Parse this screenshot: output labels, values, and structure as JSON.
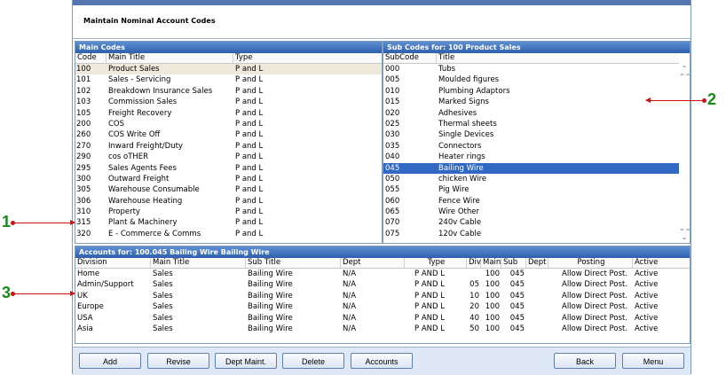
{
  "window": {
    "title": "Maintain Nominal Account Codes"
  },
  "main_codes": {
    "header": "Main Codes",
    "columns": [
      "Code",
      "Main Title",
      "Type"
    ],
    "rows": [
      {
        "code": "100",
        "title": "Product Sales",
        "type": "P and L"
      },
      {
        "code": "101",
        "title": "Sales - Servicing",
        "type": "P and L"
      },
      {
        "code": "102",
        "title": "Breakdown Insurance Sales",
        "type": "P and L"
      },
      {
        "code": "103",
        "title": "Commission Sales",
        "type": "P and L"
      },
      {
        "code": "105",
        "title": "Freight Recovery",
        "type": "P and L"
      },
      {
        "code": "200",
        "title": "COS",
        "type": "P and L"
      },
      {
        "code": "260",
        "title": "COS Write Off",
        "type": "P and L"
      },
      {
        "code": "270",
        "title": "Inward Freight/Duty",
        "type": "P and L"
      },
      {
        "code": "290",
        "title": "cos oTHER",
        "type": "P and L"
      },
      {
        "code": "295",
        "title": "Sales Agents Fees",
        "type": "P and L"
      },
      {
        "code": "300",
        "title": "Outward Freight",
        "type": "P and L"
      },
      {
        "code": "305",
        "title": "Warehouse Consumable",
        "type": "P and L"
      },
      {
        "code": "306",
        "title": "Warehouse Heating",
        "type": "P and L"
      },
      {
        "code": "310",
        "title": "Property",
        "type": "P and L"
      },
      {
        "code": "315",
        "title": "Plant & Machinery",
        "type": "P and L"
      },
      {
        "code": "320",
        "title": "E - Commerce & Comms",
        "type": "P and L"
      }
    ]
  },
  "sub_codes": {
    "header": "Sub Codes for: 100   Product Sales",
    "columns": [
      "SubCode",
      "Title"
    ],
    "rows": [
      {
        "code": "000",
        "title": "Tubs"
      },
      {
        "code": "005",
        "title": "Moulded figures"
      },
      {
        "code": "010",
        "title": "Plumbing Adaptors"
      },
      {
        "code": "015",
        "title": "Marked Signs"
      },
      {
        "code": "020",
        "title": "Adhesives"
      },
      {
        "code": "025",
        "title": "Thermal sheets"
      },
      {
        "code": "030",
        "title": "Single Devices"
      },
      {
        "code": "035",
        "title": "Connectors"
      },
      {
        "code": "040",
        "title": "Heater rings"
      },
      {
        "code": "045",
        "title": "Bailing Wire"
      },
      {
        "code": "050",
        "title": "chicken Wire"
      },
      {
        "code": "055",
        "title": "Pig Wire"
      },
      {
        "code": "060",
        "title": "Fence Wire"
      },
      {
        "code": "065",
        "title": "Wire Other"
      },
      {
        "code": "070",
        "title": "240v Cable"
      },
      {
        "code": "075",
        "title": "120v Cable"
      }
    ]
  },
  "accounts": {
    "header": "Accounts for:  100.045   Bailing Wire    Bailing Wire",
    "columns": [
      "Division",
      "Main Title",
      "Sub Title",
      "Dept",
      "Type",
      "Div",
      "Main",
      "Sub",
      "Dept",
      "Posting",
      "Active"
    ],
    "rows": [
      {
        "division": "Home",
        "main": "Sales",
        "sub": "Bailing Wire",
        "dept": "N/A",
        "type": "P AND L",
        "div": "",
        "maincode": "100",
        "subcode": "045",
        "deptcode": "",
        "posting": "Allow Direct Post.",
        "active": "Active"
      },
      {
        "division": "Admin/Support",
        "main": "Sales",
        "sub": "Bailing Wire",
        "dept": "N/A",
        "type": "P AND L",
        "div": "05",
        "maincode": "100",
        "subcode": "045",
        "deptcode": "",
        "posting": "Allow Direct Post.",
        "active": "Active"
      },
      {
        "division": "UK",
        "main": "Sales",
        "sub": "Bailing Wire",
        "dept": "N/A",
        "type": "P AND L",
        "div": "10",
        "maincode": "100",
        "subcode": "045",
        "deptcode": "",
        "posting": "Allow Direct Post.",
        "active": "Active"
      },
      {
        "division": "Europe",
        "main": "Sales",
        "sub": "Bailing Wire",
        "dept": "N/A",
        "type": "P AND L",
        "div": "20",
        "maincode": "100",
        "subcode": "045",
        "deptcode": "",
        "posting": "Allow Direct Post.",
        "active": "Active"
      },
      {
        "division": "USA",
        "main": "Sales",
        "sub": "Bailing Wire",
        "dept": "N/A",
        "type": "P AND L",
        "div": "40",
        "maincode": "100",
        "subcode": "045",
        "deptcode": "",
        "posting": "Allow Direct Post.",
        "active": "Active"
      },
      {
        "division": "Asia",
        "main": "Sales",
        "sub": "Bailing Wire",
        "dept": "N/A",
        "type": "P AND L",
        "div": "50",
        "maincode": "100",
        "subcode": "045",
        "deptcode": "",
        "posting": "Allow Direct Post.",
        "active": "Active"
      }
    ]
  },
  "buttons": {
    "add": "Add",
    "revise": "Revise",
    "dept_maint": "Dept Maint.",
    "delete": "Delete",
    "accounts": "Accounts",
    "back": "Back",
    "menu": "Menu"
  },
  "callouts": {
    "one": "1",
    "two": "2",
    "three": "3"
  },
  "icons": {
    "scroll_top": "double-chevron-up-icon",
    "scroll_up": "chevron-up-icon",
    "scroll_bottom": "double-chevron-down-icon",
    "scroll_down": "chevron-down-icon"
  },
  "colors": {
    "header_blue": "#2e5fae",
    "selected_sub": "#3168c4",
    "selected_main": "#efe9dc",
    "callout_green": "#1a8a1a",
    "arrow_red": "#cc1111"
  }
}
